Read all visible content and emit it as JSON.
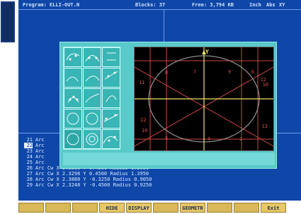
{
  "status_bar": {
    "program": "Program: ELLI-OUT.N",
    "blocks": "Blocks: 37",
    "free": "Free: 3,794 KB",
    "units": "Inch",
    "mode": "Abs",
    "plane": "XY"
  },
  "listing": [
    {
      "num": "21",
      "text": "Arc"
    },
    {
      "num": "22",
      "text": "Arc"
    },
    {
      "num": "23",
      "text": "Arc"
    },
    {
      "num": "24",
      "text": "Arc"
    },
    {
      "num": "25",
      "text": "Arc"
    },
    {
      "num": "26",
      "text": "Arc Cw   X 2.1508 Y 0.4500 Radius 1.2050"
    },
    {
      "num": "27",
      "text": "Arc Cw   X 2.3298 Y 0.4500 Radius 1.3950"
    },
    {
      "num": "28",
      "text": "Arc Cw   X 2.3888 Y -0.3250 Radius 0.9050"
    },
    {
      "num": "29",
      "text": "Arc Cw   X 2.3248 Y -0.4500 Radius 0.9250"
    }
  ],
  "dialog": {
    "palette_icons": [
      "ellipse-arc-icon",
      "arc-bridge-icon",
      "line-end-icon",
      "fillet-arc-icon",
      "arc-through-point-icon",
      "chord-icon",
      "three-point-arc-icon",
      "tangent-arc-icon",
      "offset-arc-icon",
      "circle-center-icon",
      "diagonal-circle-icon",
      "tangent-points-icon",
      "full-circle-icon",
      "concentric-circle-icon",
      "arc-chain-icon"
    ]
  },
  "canvas_labels": {
    "left": [
      "11",
      "12",
      "10"
    ],
    "right": [
      "12",
      "10",
      "13"
    ],
    "top": [
      "8",
      "7",
      "9",
      "6"
    ],
    "bottom": [
      "5",
      "4",
      "2"
    ],
    "axis": "Y"
  },
  "softkeys": [
    "",
    "",
    "",
    "HIDE",
    "DISPLAY",
    "",
    "GEOMETR",
    "",
    "",
    "Exit"
  ],
  "colors": {
    "screen": "#0f47a8",
    "dialog": "#59c9c9",
    "canvas": "#000000",
    "softkey": "#d8b857",
    "circle": "#7f7f7f",
    "construction": "#d54c4c",
    "axis": "#f0e46e"
  }
}
